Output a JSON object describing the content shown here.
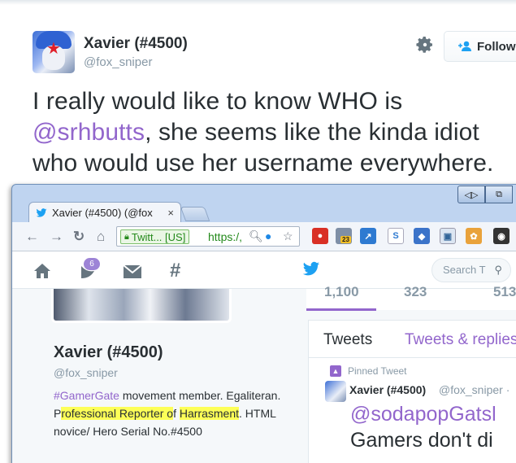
{
  "tweet": {
    "display_name": "Xavier (#4500)",
    "handle": "@fox_sniper",
    "follow_label": "Follow",
    "text_part1": "I really would like to know WHO is",
    "mention": "@srhbutts",
    "text_part2": ", she seems like the kinda idiot who would use her username everywhere."
  },
  "browser": {
    "tab_title": "Xavier (#4500) (@fox",
    "tab_close": "×",
    "ev_label": "Twitt... [US]",
    "url": "https:/,",
    "ext_badge": "23"
  },
  "twitter": {
    "notification_count": "6",
    "search_placeholder": "Search T",
    "stats": [
      "1,100",
      "323",
      "513"
    ],
    "profile": {
      "name": "Xavier (#4500)",
      "handle": "@fox_sniper",
      "bio_hashtag": "#GamerGate",
      "bio_part1": " movement member. Egaliteran. P",
      "bio_hl1": "rofessional Reporter o",
      "bio_part2": "f ",
      "bio_hl2": "Harrasment",
      "bio_part3": ". HTML novice/ Hero Serial No.#4500"
    },
    "timeline": {
      "tab_tweets": "Tweets",
      "tab_replies": "Tweets & replies",
      "pinned_label": "Pinned Tweet",
      "author_name": "Xavier (#4500)",
      "author_handle": "@fox_sniper ·",
      "mention": "@sodapopGatsl",
      "body": "Gamers don't di"
    }
  },
  "colors": {
    "twitter_purple": "#9266cc",
    "twitter_blue": "#1da1f2",
    "highlight": "#fdff57",
    "text_primary": "#292f33",
    "text_secondary": "#8899a6"
  },
  "icons": [
    "gear-icon",
    "follow-plus-icon",
    "twitter-tab-icon",
    "back-icon",
    "forward-icon",
    "reload-icon",
    "home-icon",
    "lock-icon",
    "zoom-icon",
    "star-icon",
    "twitter-bird-icon",
    "messages-icon",
    "moments-icon",
    "notifications-icon",
    "search-icon",
    "pin-icon"
  ]
}
